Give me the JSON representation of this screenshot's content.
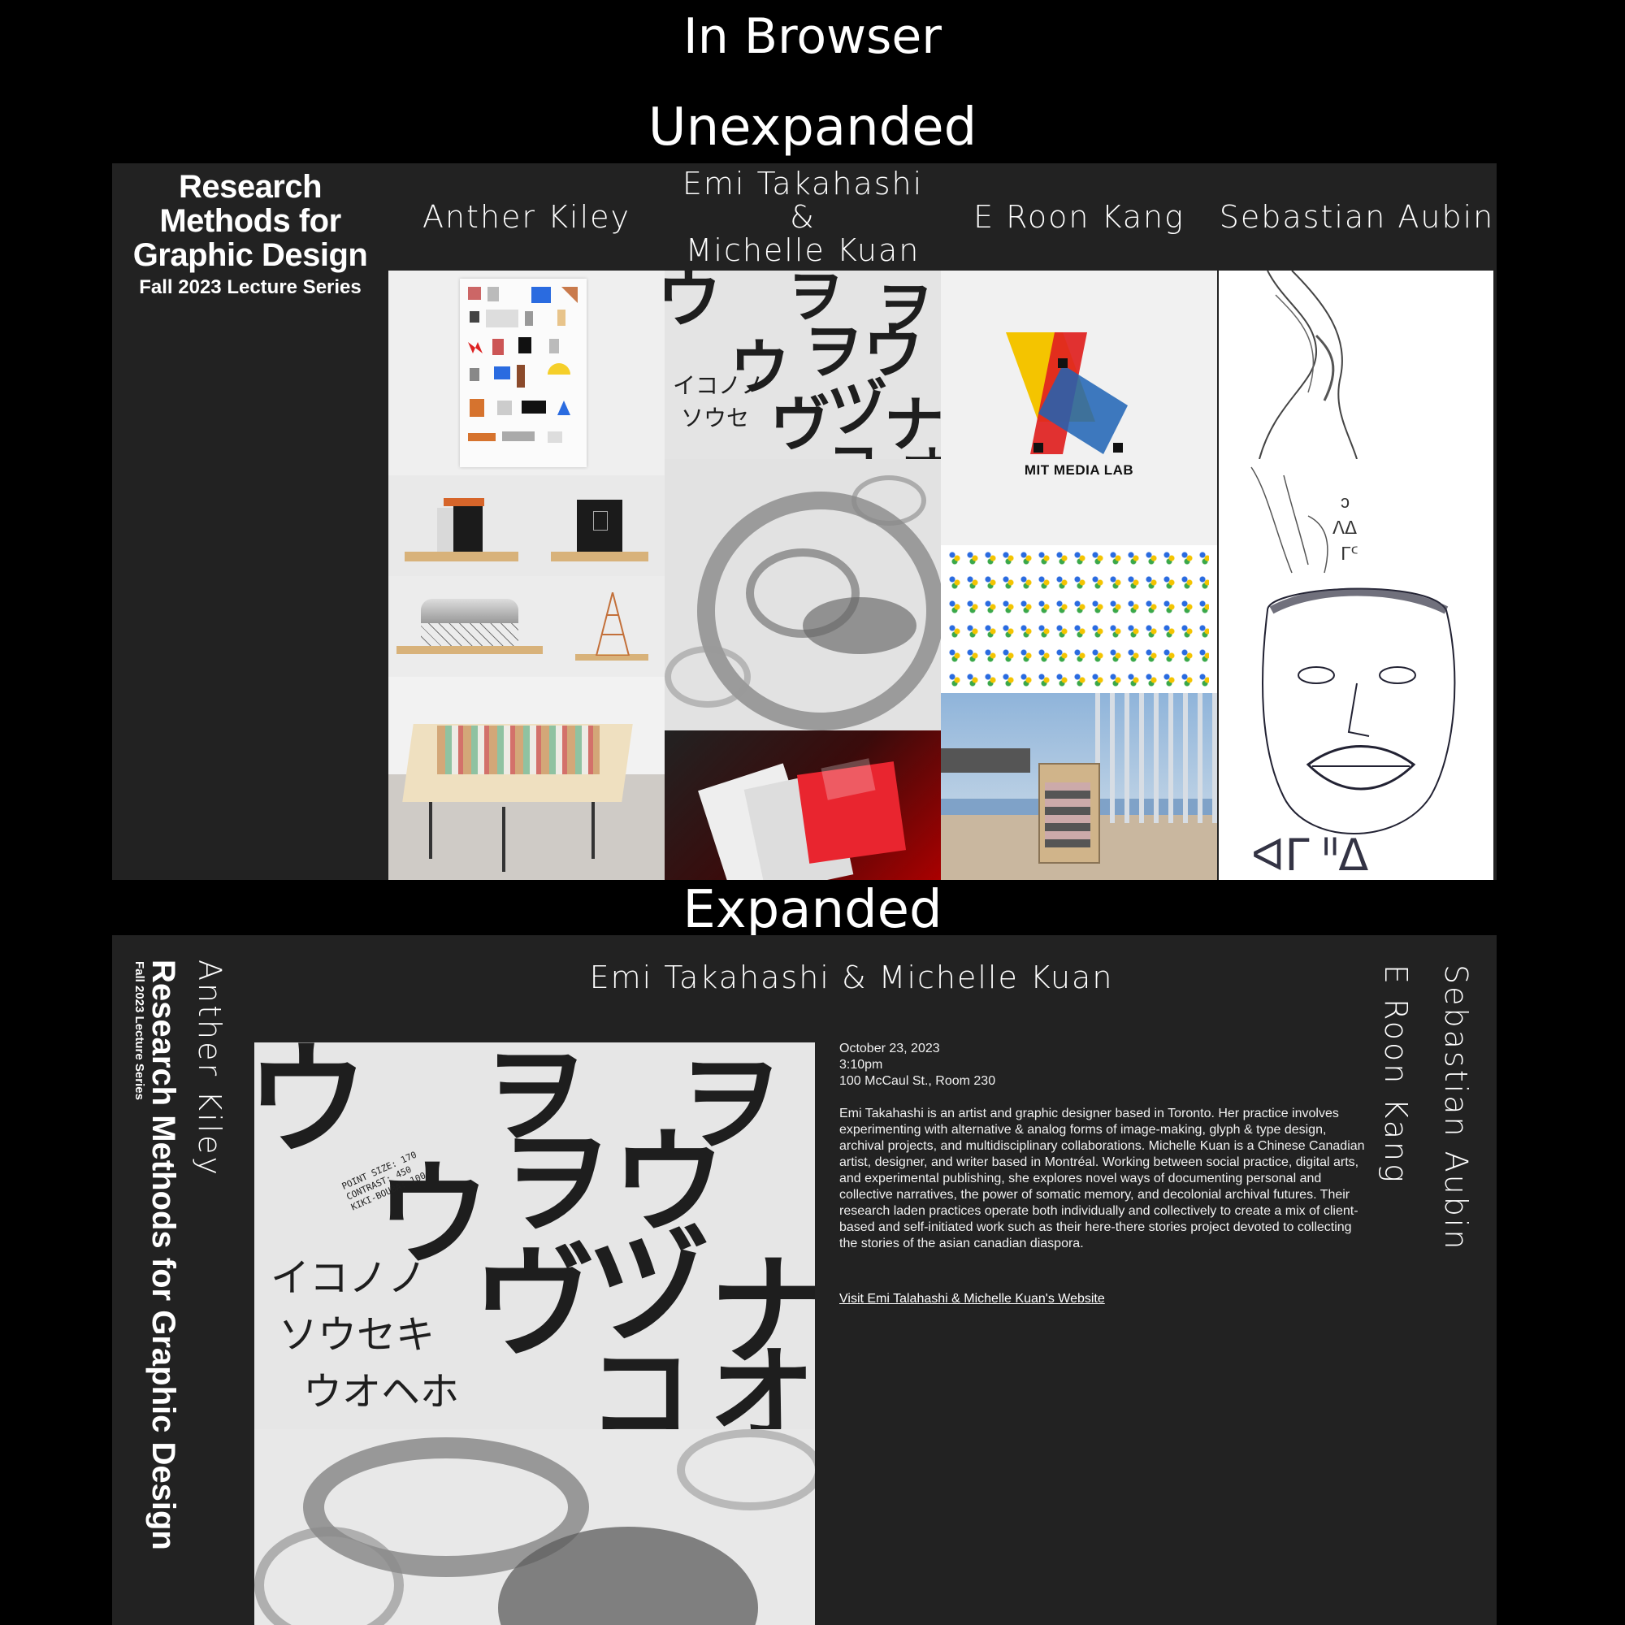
{
  "headings": {
    "in_browser": "In Browser",
    "unexpanded": "Unexpanded",
    "expanded": "Expanded"
  },
  "site": {
    "title": "Research Methods for Graphic Design",
    "title_lines": [
      "Research",
      "Methods for",
      "Graphic Design"
    ],
    "subtitle": "Fall 2023 Lecture Series"
  },
  "speakers": [
    {
      "name": "Anther Kiley"
    },
    {
      "name": "Emi Takahashi & Michelle Kuan",
      "name_lines": [
        "Emi Takahashi &",
        "Michelle Kuan"
      ]
    },
    {
      "name": "E Roon Kang"
    },
    {
      "name": "Sebastian Aubin"
    }
  ],
  "images": {
    "mit_logo_text": "MIT MEDIA LAB",
    "poster_specs": [
      "POINT SIZE:  170",
      "CONTRAST:  450",
      "KIKI-BOUBA:  100"
    ]
  },
  "expanded": {
    "active_speaker": "Emi Takahashi & Michelle Kuan",
    "date": "October 23, 2023",
    "time": "3:10pm",
    "location": "100 McCaul St., Room 230",
    "bio": "Emi Takahashi is an artist and graphic designer based in Toronto. Her practice involves experimenting with alternative & analog forms of image-making, glyph & type design, archival projects, and multidisciplinary collaborations. Michelle Kuan is a Chinese Canadian artist, designer, and writer based in Montréal. Working between social practice, digital arts, and experimental publishing, she explores novel ways of documenting personal and collective narratives, the power of somatic memory, and decolonial archival futures. Their research laden practices operate both individually and collectively to create a mix of client-based and self-initiated work such as their here-there stories project devoted to collecting the stories of the asian canadian diaspora.",
    "link_text": "Visit Emi Talahashi & Michelle Kuan's Website"
  }
}
